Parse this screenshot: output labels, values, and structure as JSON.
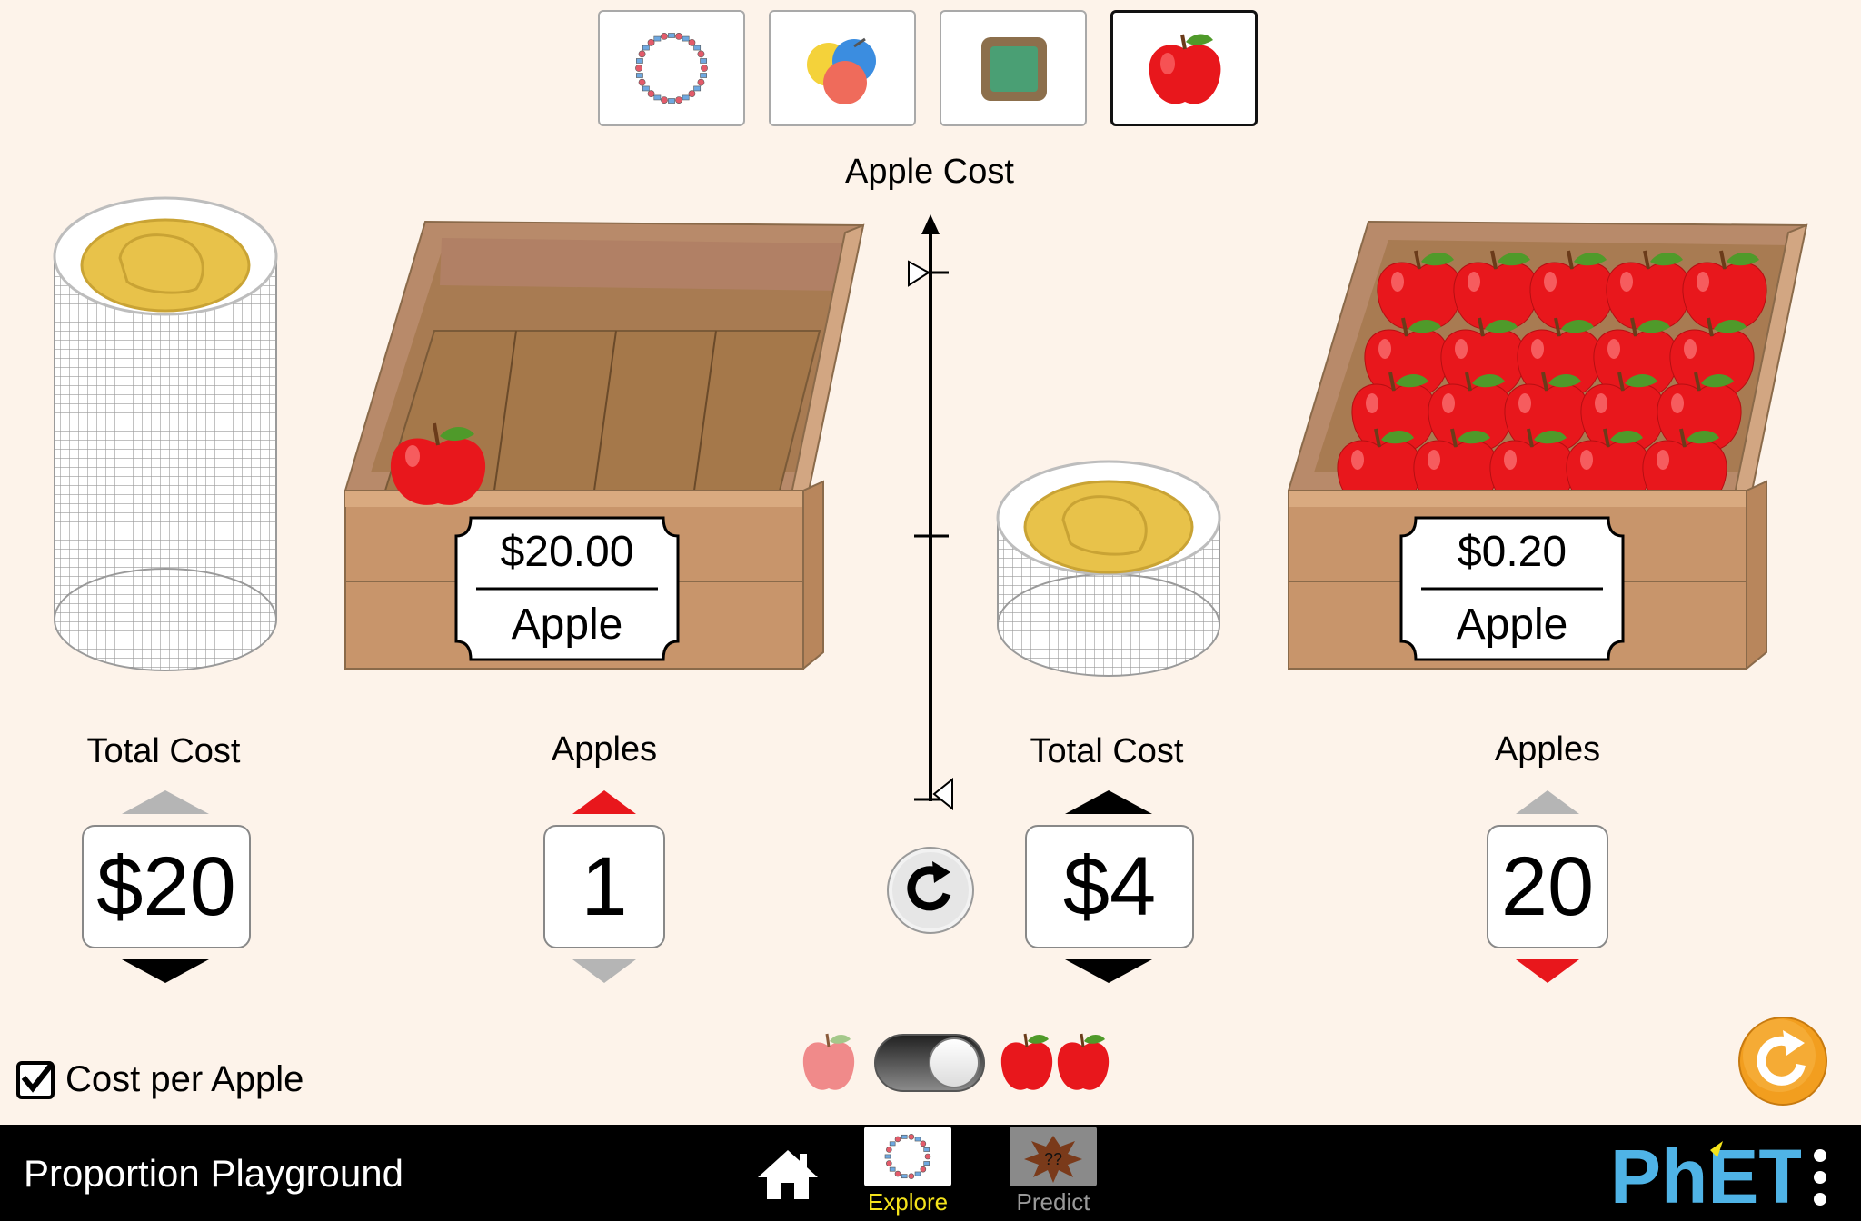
{
  "app": {
    "title": "Proportion Playground"
  },
  "scene_tabs": [
    {
      "name": "necklace",
      "icon": "necklace-icon",
      "selected": false
    },
    {
      "name": "paint",
      "icon": "paint-balloons-icon",
      "selected": false
    },
    {
      "name": "billiards",
      "icon": "billiards-table-icon",
      "selected": false
    },
    {
      "name": "apples",
      "icon": "apple-icon",
      "selected": true
    }
  ],
  "scale": {
    "title": "Apple Cost"
  },
  "left": {
    "price_tag": {
      "numerator": "$20.00",
      "denominator": "Apple"
    },
    "total_cost": {
      "label": "Total Cost",
      "value": "$20"
    },
    "apples": {
      "label": "Apples",
      "value": "1"
    }
  },
  "right": {
    "price_tag": {
      "numerator": "$0.20",
      "denominator": "Apple"
    },
    "total_cost": {
      "label": "Total Cost",
      "value": "$4"
    },
    "apples": {
      "label": "Apples",
      "value": "20"
    }
  },
  "options": {
    "cost_per_apple_label": "Cost per Apple",
    "cost_per_apple_checked": true
  },
  "nav": {
    "screens": [
      {
        "label": "Explore",
        "selected": true
      },
      {
        "label": "Predict",
        "selected": false
      }
    ],
    "logo": "PhET"
  },
  "colors": {
    "background": "#fdf3ea",
    "crate": "#c8956b",
    "apple_red": "#e8171c",
    "coin_gold": "#e8c24a",
    "nav_selected": "#f4e31b",
    "reset_orange": "#f29e1f"
  }
}
